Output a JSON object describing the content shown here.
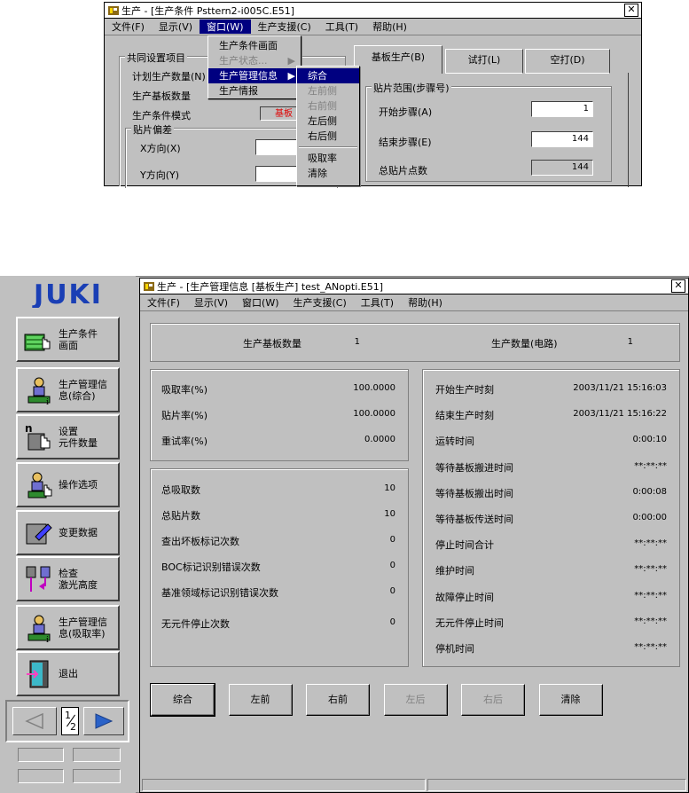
{
  "top_window": {
    "title": "生产 - [生产条件 Psttern2-i005C.E51]",
    "close": "✕",
    "menu": [
      "文件(F)",
      "显示(V)",
      "窗口(W)",
      "生产支援(C)",
      "工具(T)",
      "帮助(H)"
    ],
    "tabs": [
      "基板生产(B)",
      "试打(L)",
      "空打(D)"
    ],
    "common_group": {
      "title": "共同设置项目",
      "planned_qty_label": "计划生产数量(N)",
      "board_qty_label": "生产基板数量",
      "mode_label": "生产条件模式",
      "mode_value": "基板"
    },
    "offset_group": {
      "title": "贴片偏差",
      "x_label": "X方向(X)",
      "y_label": "Y方向(Y)"
    },
    "range_group": {
      "title": "贴片范围(步骤号)",
      "start_label": "开始步骤(A)",
      "start_value": "1",
      "end_label": "结束步骤(E)",
      "end_value": "144",
      "total_label": "总贴片点数",
      "total_value": "144"
    },
    "window_menu": {
      "items": [
        "生产条件画面",
        "生产状态...",
        "生产管理信息",
        "生产情报"
      ],
      "arrow": "▶"
    },
    "submenu": {
      "items": [
        "综合",
        "左前侧",
        "右前侧",
        "左后侧",
        "右后侧",
        "吸取率",
        "清除"
      ]
    }
  },
  "sidebar": {
    "logo": "JUKI",
    "buttons": [
      {
        "label": "生产条件\n画面",
        "icon": "hand-pointer-icon"
      },
      {
        "label": "生产管理信\n息(综合)",
        "icon": "operator-info-icon"
      },
      {
        "label": "设置\n元件数量",
        "icon": "parts-count-icon"
      },
      {
        "label": "操作选项",
        "icon": "operator-icon"
      },
      {
        "label": "变更数据",
        "icon": "edit-data-icon"
      },
      {
        "label": "检查\n激光高度",
        "icon": "laser-height-icon"
      },
      {
        "label": "生产管理信\n息(吸取率)",
        "icon": "operator-pickup-icon"
      },
      {
        "label": "退出",
        "icon": "exit-door-icon"
      }
    ],
    "page_indicator_top": "1",
    "page_indicator_bottom": "2"
  },
  "main_window": {
    "title": "生产 - [生产管理信息 [基板生产] test_ANopti.E51]",
    "close": "✕",
    "menu": [
      "文件(F)",
      "显示(V)",
      "窗口(W)",
      "生产支援(C)",
      "工具(T)",
      "帮助(H)"
    ],
    "summary": {
      "board_qty_label": "生产基板数量",
      "board_qty_value": "1",
      "circuit_qty_label": "生产数量(电路)",
      "circuit_qty_value": "1"
    },
    "rates": [
      {
        "label": "吸取率(%)",
        "value": "100.0000"
      },
      {
        "label": "贴片率(%)",
        "value": "100.0000"
      },
      {
        "label": "重试率(%)",
        "value": "0.0000"
      }
    ],
    "counts": [
      {
        "label": "总吸取数",
        "value": "10"
      },
      {
        "label": "总贴片数",
        "value": "10"
      },
      {
        "label": "查出坏板标记次数",
        "value": "0"
      },
      {
        "label": "BOC标记识别错误次数",
        "value": "0"
      },
      {
        "label": "基准领域标记识别错误次数",
        "value": "0"
      },
      {
        "label": "无元件停止次数",
        "value": "0"
      }
    ],
    "times": [
      {
        "label": "开始生产时刻",
        "value": "2003/11/21 15:16:03"
      },
      {
        "label": "结束生产时刻",
        "value": "2003/11/21 15:16:22"
      },
      {
        "label": "运转时间",
        "value": "0:00:10"
      },
      {
        "label": "等待基板搬进时间",
        "value": "**:**:**"
      },
      {
        "label": "等待基板搬出时间",
        "value": "0:00:08"
      },
      {
        "label": "等待基板传送时间",
        "value": "0:00:00"
      },
      {
        "label": "停止时间合计",
        "value": "**:**:**"
      },
      {
        "label": "维护时间",
        "value": "**:**:**"
      },
      {
        "label": "故障停止时间",
        "value": "**:**:**"
      },
      {
        "label": "无元件停止时间",
        "value": "**:**:**"
      },
      {
        "label": "停机时间",
        "value": "**:**:**"
      }
    ],
    "buttons": [
      {
        "label": "综合",
        "enabled": true
      },
      {
        "label": "左前",
        "enabled": true
      },
      {
        "label": "右前",
        "enabled": true
      },
      {
        "label": "左后",
        "enabled": false
      },
      {
        "label": "右后",
        "enabled": false
      },
      {
        "label": "清除",
        "enabled": true
      }
    ]
  },
  "colors": {
    "face": "#c0c0c0",
    "highlight": "#000080",
    "logo_blue": "#1a3fb5",
    "mode_red": "#e00000",
    "arrow_blue": "#2a62c8"
  }
}
